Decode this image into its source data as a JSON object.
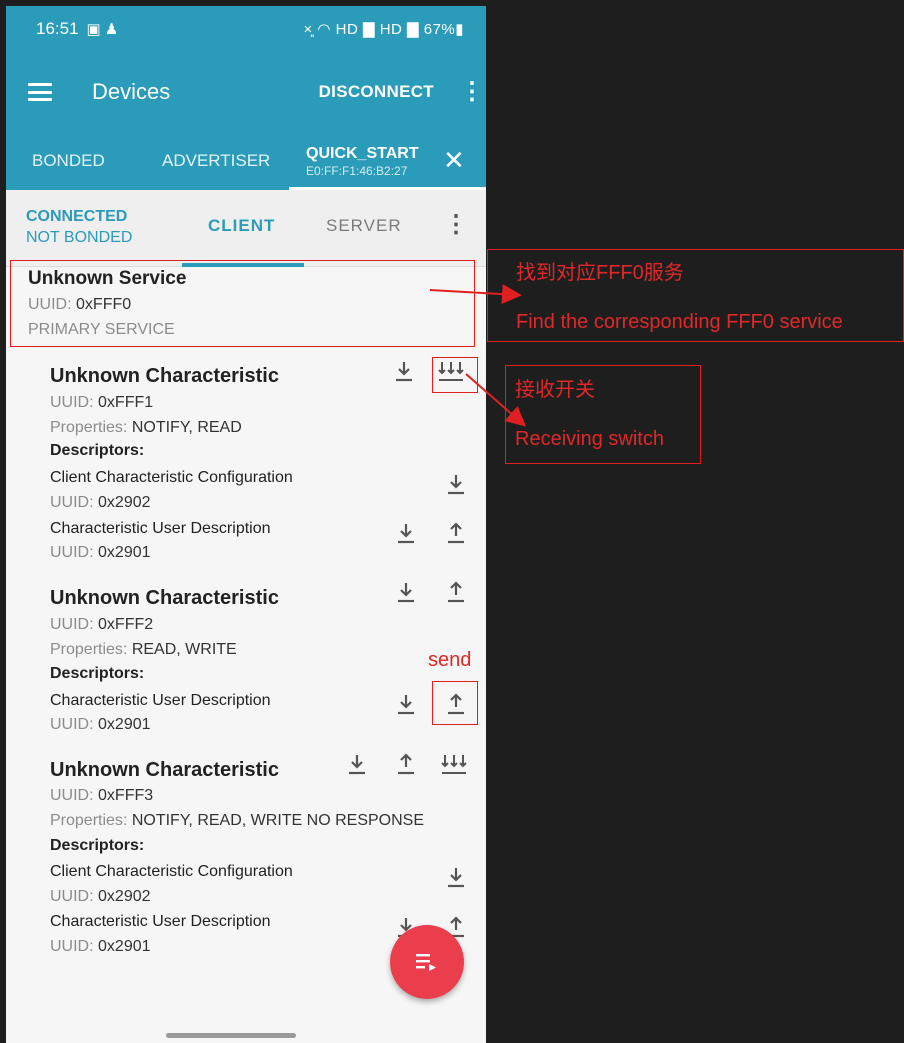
{
  "status_bar": {
    "time": "16:51",
    "left_icons": "▣ ♟",
    "right": "×͈ ◠ HD ▇ HD ▇ 67%▮"
  },
  "app_bar": {
    "title": "Devices",
    "disconnect": "DISCONNECT"
  },
  "device_tabs": {
    "bonded": "BONDED",
    "advertiser": "ADVERTISER",
    "device_name": "QUICK_START",
    "device_address": "E0:FF:F1:46:B2:27"
  },
  "conn_tabs": {
    "status1": "CONNECTED",
    "status2": "NOT BONDED",
    "client": "CLIENT",
    "server": "SERVER"
  },
  "service": {
    "name": "Unknown Service",
    "uuid_label": "UUID:",
    "uuid": "0xFFF0",
    "type": "PRIMARY SERVICE"
  },
  "characteristics": [
    {
      "name": "Unknown Characteristic",
      "uuid_label": "UUID:",
      "uuid": "0xFFF1",
      "props_label": "Properties:",
      "props": "NOTIFY, READ",
      "descriptors_label": "Descriptors:",
      "descriptors": [
        {
          "name": "Client Characteristic Configuration",
          "uuid_label": "UUID:",
          "uuid": "0x2902"
        },
        {
          "name": "Characteristic User Description",
          "uuid_label": "UUID:",
          "uuid": "0x2901"
        }
      ]
    },
    {
      "name": "Unknown Characteristic",
      "uuid_label": "UUID:",
      "uuid": "0xFFF2",
      "props_label": "Properties:",
      "props": "READ, WRITE",
      "descriptors_label": "Descriptors:",
      "descriptors": [
        {
          "name": "Characteristic User Description",
          "uuid_label": "UUID:",
          "uuid": "0x2901"
        }
      ]
    },
    {
      "name": "Unknown Characteristic",
      "uuid_label": "UUID:",
      "uuid": "0xFFF3",
      "props_label": "Properties:",
      "props": "NOTIFY, READ, WRITE NO RESPONSE",
      "descriptors_label": "Descriptors:",
      "descriptors": [
        {
          "name": "Client Characteristic Configuration",
          "uuid_label": "UUID:",
          "uuid": "0x2902"
        },
        {
          "name": "Characteristic User Description",
          "uuid_label": "UUID:",
          "uuid": "0x2901"
        }
      ]
    }
  ],
  "annotations": {
    "service_cn": "找到对应FFF0服务",
    "service_en": "Find the corresponding FFF0 service",
    "switch_cn": "接收开关",
    "switch_en": "Receiving switch",
    "send": "send"
  },
  "colors": {
    "accent": "#2a9bb8",
    "fab": "#ea3e4d",
    "annotation": "#e02020",
    "right_panel": "#1e1e1e"
  }
}
